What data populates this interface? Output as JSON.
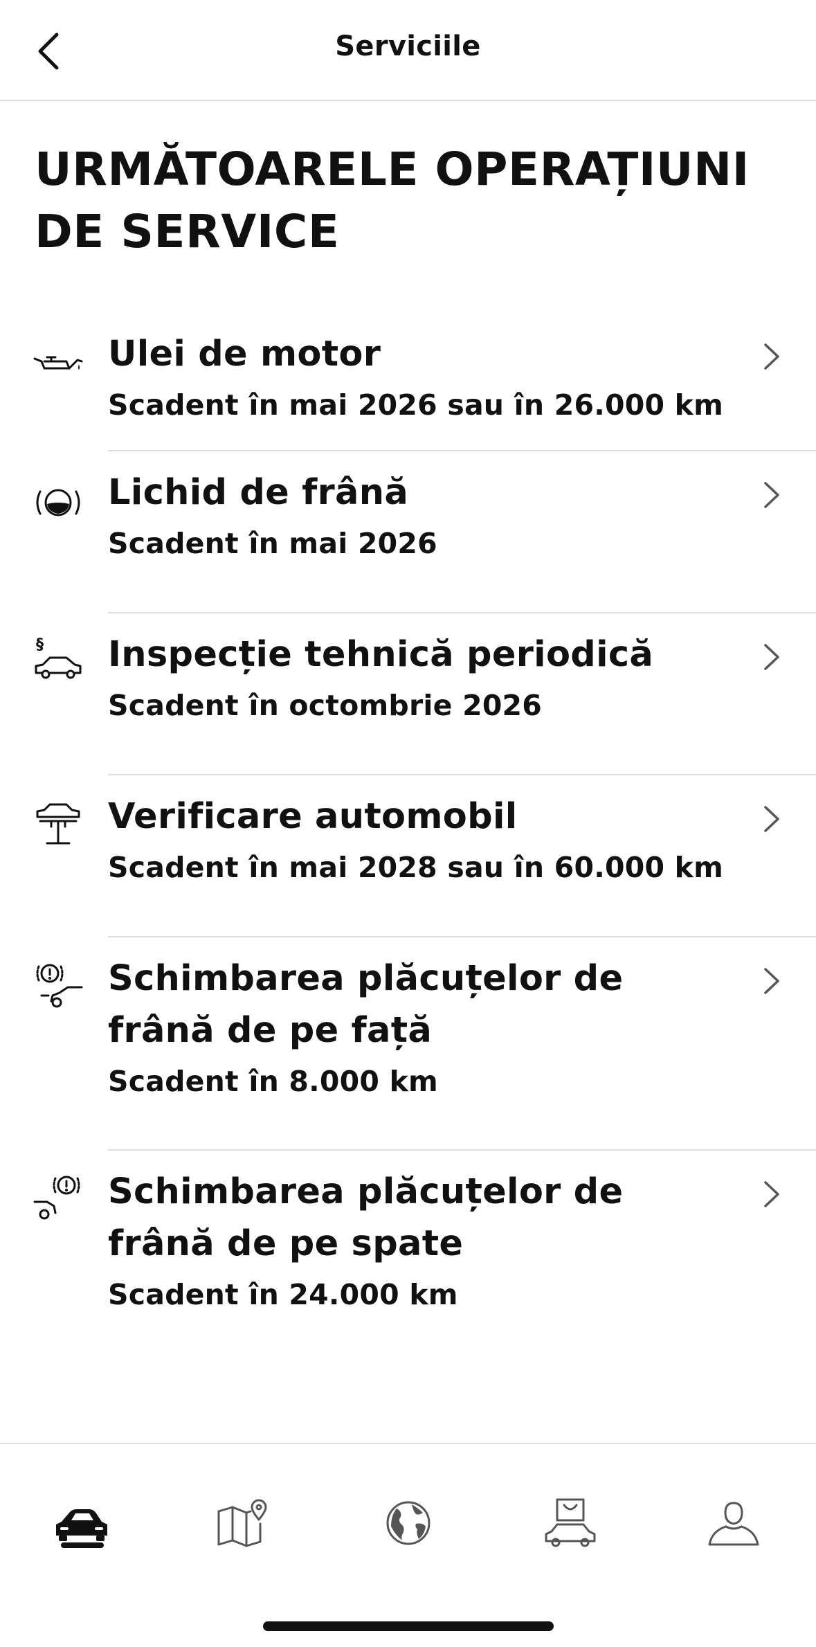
{
  "header": {
    "title": "Serviciile",
    "back_icon": "chevron-left-icon"
  },
  "section": {
    "title": "URMĂTOARELE OPERAȚIUNI DE SERVICE"
  },
  "services": [
    {
      "icon": "oil-can-icon",
      "title": "Ulei de motor",
      "subtitle": "Scadent în mai 2026 sau în 26.000 km"
    },
    {
      "icon": "brake-fluid-icon",
      "title": "Lichid de frână",
      "subtitle": "Scadent în mai 2026"
    },
    {
      "icon": "inspection-car-icon",
      "title": "Inspecție tehnică periodică",
      "subtitle": "Scadent în octombrie 2026"
    },
    {
      "icon": "car-lift-icon",
      "title": "Verificare automobil",
      "subtitle": "Scadent în mai 2028 sau în 60.000 km"
    },
    {
      "icon": "front-brake-pads-icon",
      "title": "Schimbarea plăcuțelor de frână de pe față",
      "subtitle": "Scadent în 8.000 km"
    },
    {
      "icon": "rear-brake-pads-icon",
      "title": "Schimbarea plăcuțelor de frână de pe spate",
      "subtitle": "Scadent în 24.000 km"
    }
  ],
  "tabs": [
    {
      "icon": "car-icon",
      "active": true
    },
    {
      "icon": "map-pin-icon",
      "active": false
    },
    {
      "icon": "globe-icon",
      "active": false
    },
    {
      "icon": "shop-car-icon",
      "active": false
    },
    {
      "icon": "profile-icon",
      "active": false
    }
  ],
  "colors": {
    "text": "#111111",
    "divider": "#dedede",
    "background": "#ffffff",
    "chevron": "#555555"
  }
}
